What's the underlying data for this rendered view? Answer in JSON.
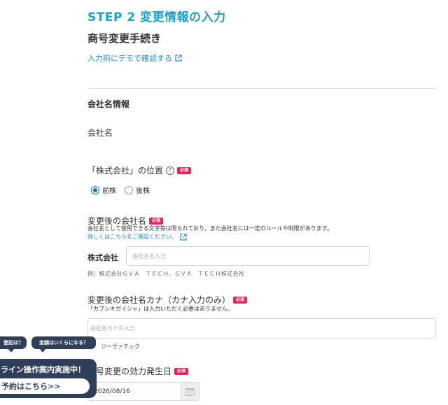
{
  "header": {
    "step_title": "STEP 2  変更情報の入力",
    "section_title": "商号変更手続き",
    "demo_link": "入力前にデモで確認する"
  },
  "company_info": {
    "group_title": "会社名情報",
    "company_label": "会社名"
  },
  "position_field": {
    "label": "「株式会社」の位置",
    "required": "必須",
    "options": [
      "前株",
      "後株"
    ],
    "selected": "前株"
  },
  "new_name_field": {
    "label": "変更後の会社名",
    "required": "必須",
    "note": "会社名として使用できる文字等は限られており、また会社名には一定のルールや制限があります。",
    "details_link": "詳しくはこちらをご確認ください。",
    "prefix": "株式会社",
    "placeholder": "会社名を入力",
    "example": "例）株式会社ＧＶＡ　ＴＥＣＨ、ＧＶＡ　ＴＥＣＨ株式会社"
  },
  "kana_field": {
    "label": "変更後の会社名カナ（カナ入力のみ）",
    "required": "必須",
    "note": "「カブシキガイシャ」は入力いただく必要はありません。",
    "placeholder": "会社名カナの入力",
    "hint": "ジーヴァテック"
  },
  "effective_date_field": {
    "label": "商号変更の効力発生日",
    "required": "必須",
    "value": "2026/08/16"
  },
  "chat_overlay": {
    "bubble_1": "登記は？",
    "bubble_2": "金額はいくらになる？",
    "banner_title": "ライン操作案内実施中！",
    "cta": "予約はこちら>>"
  },
  "colors": {
    "accent": "#1aa3c6",
    "link": "#1a8fc9",
    "required_badge": "#e5245a",
    "overlay": "#2f3f5a"
  }
}
